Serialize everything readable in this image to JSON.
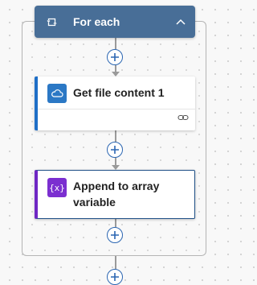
{
  "foreach": {
    "title": "For each",
    "header_color": "#486e97",
    "icon": "loop-icon",
    "collapse_icon": "chevron-up-icon"
  },
  "actions": [
    {
      "title": "Get file content 1",
      "icon": "onedrive-cloud-icon",
      "icon_color": "#2b78c5",
      "accent_color": "#1f6fc7",
      "footer_icon": "link-icon"
    },
    {
      "title": "Append to array variable",
      "icon": "variable-icon",
      "icon_text": "{x}",
      "icon_color": "#7b2fd0",
      "accent_color": "#6f27c4",
      "selected": true
    }
  ],
  "insert_step": {
    "icon": "plus-icon",
    "color": "#2b66b2"
  }
}
